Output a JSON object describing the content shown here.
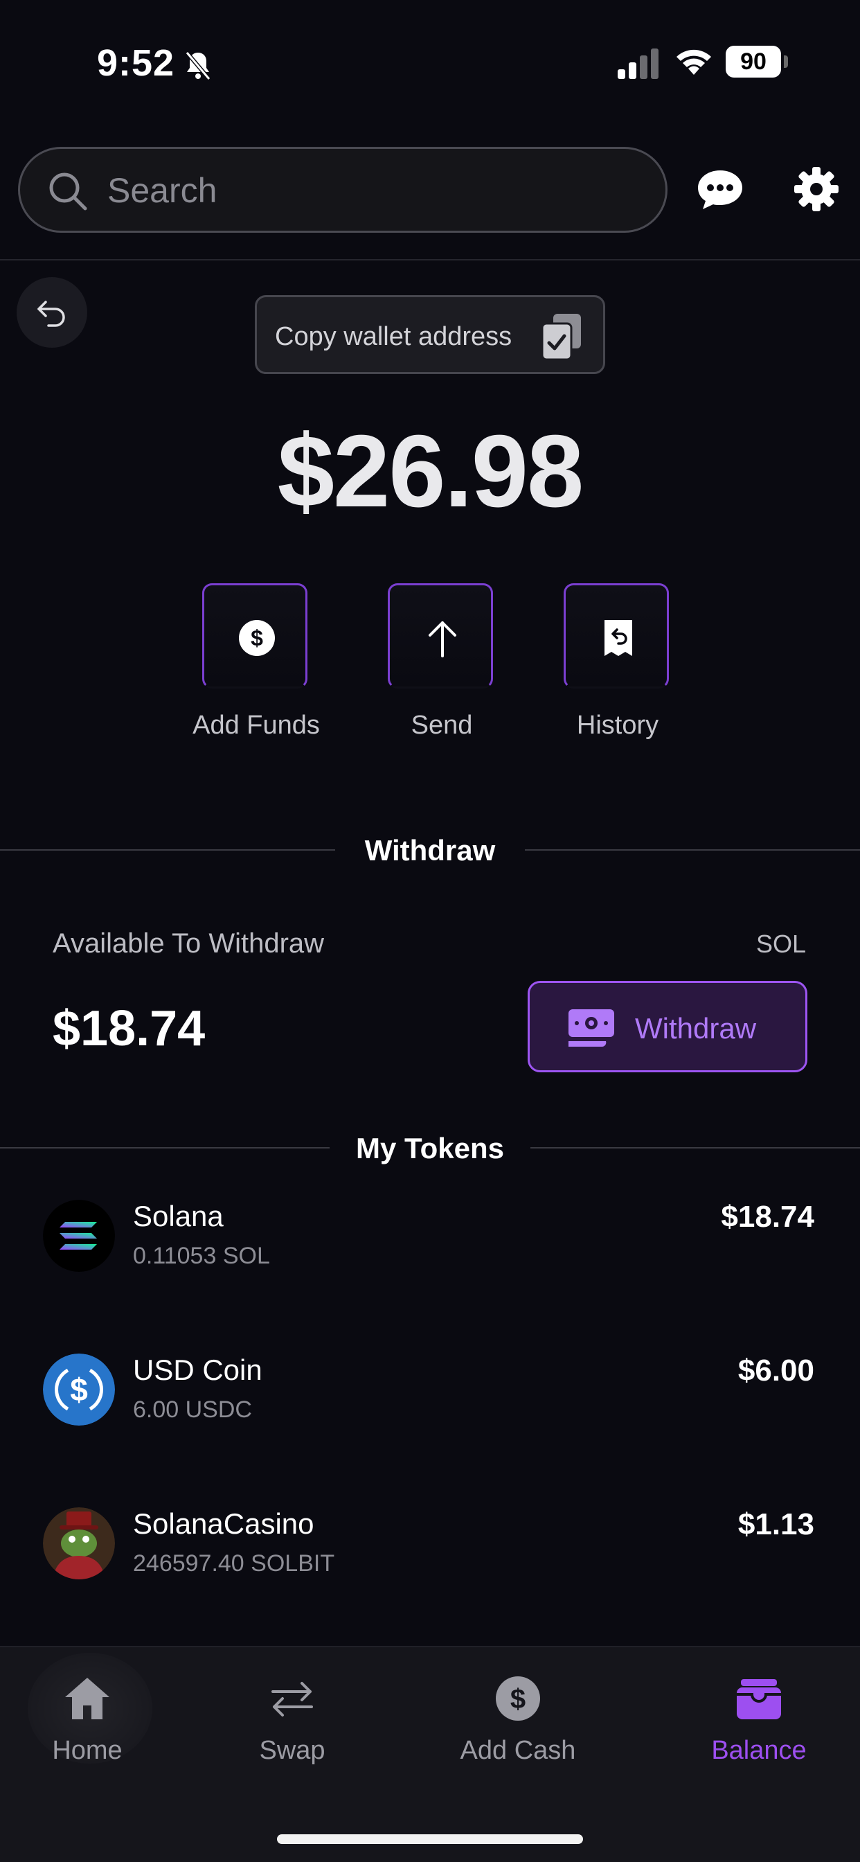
{
  "status_bar": {
    "time": "9:52",
    "battery": "90"
  },
  "header": {
    "search_placeholder": "Search"
  },
  "wallet": {
    "copy_label": "Copy wallet address",
    "total_balance": "$26.98",
    "actions": [
      {
        "label": "Add Funds",
        "icon": "dollar-circle-icon"
      },
      {
        "label": "Send",
        "icon": "arrow-up-icon"
      },
      {
        "label": "History",
        "icon": "receipt-icon"
      }
    ]
  },
  "withdraw_section": {
    "title": "Withdraw",
    "available_label": "Available To Withdraw",
    "currency": "SOL",
    "available_amount": "$18.74",
    "button_label": "Withdraw"
  },
  "tokens_section": {
    "title": "My Tokens",
    "tokens": [
      {
        "name": "Solana",
        "quantity": "0.11053 SOL",
        "value": "$18.74"
      },
      {
        "name": "USD Coin",
        "quantity": "6.00 USDC",
        "value": "$6.00"
      },
      {
        "name": "SolanaCasino",
        "quantity": "246597.40 SOLBIT",
        "value": "$1.13"
      }
    ]
  },
  "tab_bar": {
    "tabs": [
      {
        "label": "Home",
        "icon": "home-icon"
      },
      {
        "label": "Swap",
        "icon": "swap-icon"
      },
      {
        "label": "Add Cash",
        "icon": "dollar-icon"
      },
      {
        "label": "Balance",
        "icon": "wallet-icon",
        "active": true
      }
    ]
  },
  "colors": {
    "accent": "#9d4ff0",
    "background": "#0a0a11"
  }
}
